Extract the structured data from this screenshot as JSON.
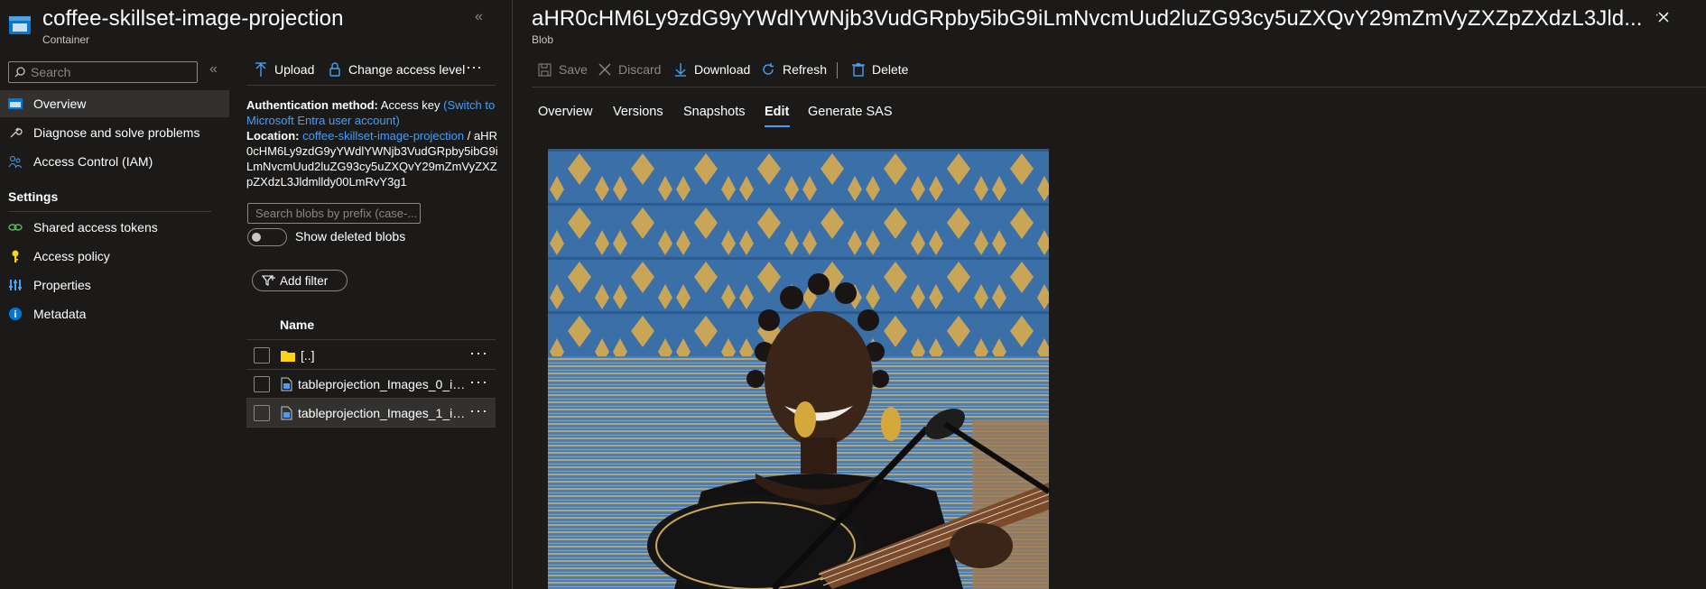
{
  "left_blade": {
    "title": "coffee-skillset-image-projection",
    "subtitle": "Container",
    "search_placeholder": "Search",
    "menu": [
      {
        "label": "Overview",
        "icon": "container-overview-icon"
      },
      {
        "label": "Diagnose and solve problems",
        "icon": "wrench-icon"
      },
      {
        "label": "Access Control (IAM)",
        "icon": "people-icon"
      }
    ],
    "settings_header": "Settings",
    "settings": [
      {
        "label": "Shared access tokens",
        "icon": "link-icon"
      },
      {
        "label": "Access policy",
        "icon": "key-icon"
      },
      {
        "label": "Properties",
        "icon": "sliders-icon"
      },
      {
        "label": "Metadata",
        "icon": "info-icon"
      }
    ]
  },
  "container_pane": {
    "toolbar": {
      "upload": "Upload",
      "change_access": "Change access level",
      "more": "···"
    },
    "auth_label": "Authentication method:",
    "auth_value": "Access key",
    "auth_switch": "(Switch to Microsoft Entra user account)",
    "location_label": "Location:",
    "location_link": "coffee-skillset-image-projection",
    "location_sep": "/",
    "location_path": "aHR0cHM6Ly9zdG9yYWdlYWNjb3VudGRpby5ibG9iLmNvcmUud2luZG93cy5uZXQvY29mZmVyZXZpZXdzL3Jldmlldy00LmRvY3g1",
    "search_blobs_placeholder": "Search blobs by prefix (case-...",
    "show_deleted": "Show deleted blobs",
    "add_filter": "Add filter",
    "column_name": "Name",
    "rows": [
      {
        "name": "[..]",
        "icon": "folder-icon"
      },
      {
        "name": "tableprojection_Images_0_img...",
        "icon": "file-icon"
      },
      {
        "name": "tableprojection_Images_1_img...",
        "icon": "file-icon"
      }
    ]
  },
  "blob_blade": {
    "title": "aHR0cHM6Ly9zdG9yYWdlYWNjb3VudGRpby5ibG9iLmNvcmUud2luZG93cy5uZXQvY29mZmVyZXZpZXdzL3Jld...",
    "subtitle": "Blob",
    "toolbar": {
      "save": "Save",
      "discard": "Discard",
      "download": "Download",
      "refresh": "Refresh",
      "delete": "Delete"
    },
    "tabs": [
      "Overview",
      "Versions",
      "Snapshots",
      "Edit",
      "Generate SAS"
    ],
    "active_tab": "Edit"
  },
  "colors": {
    "accent": "#479ef5",
    "background": "#1b1a19",
    "divider": "#3b3a39"
  }
}
